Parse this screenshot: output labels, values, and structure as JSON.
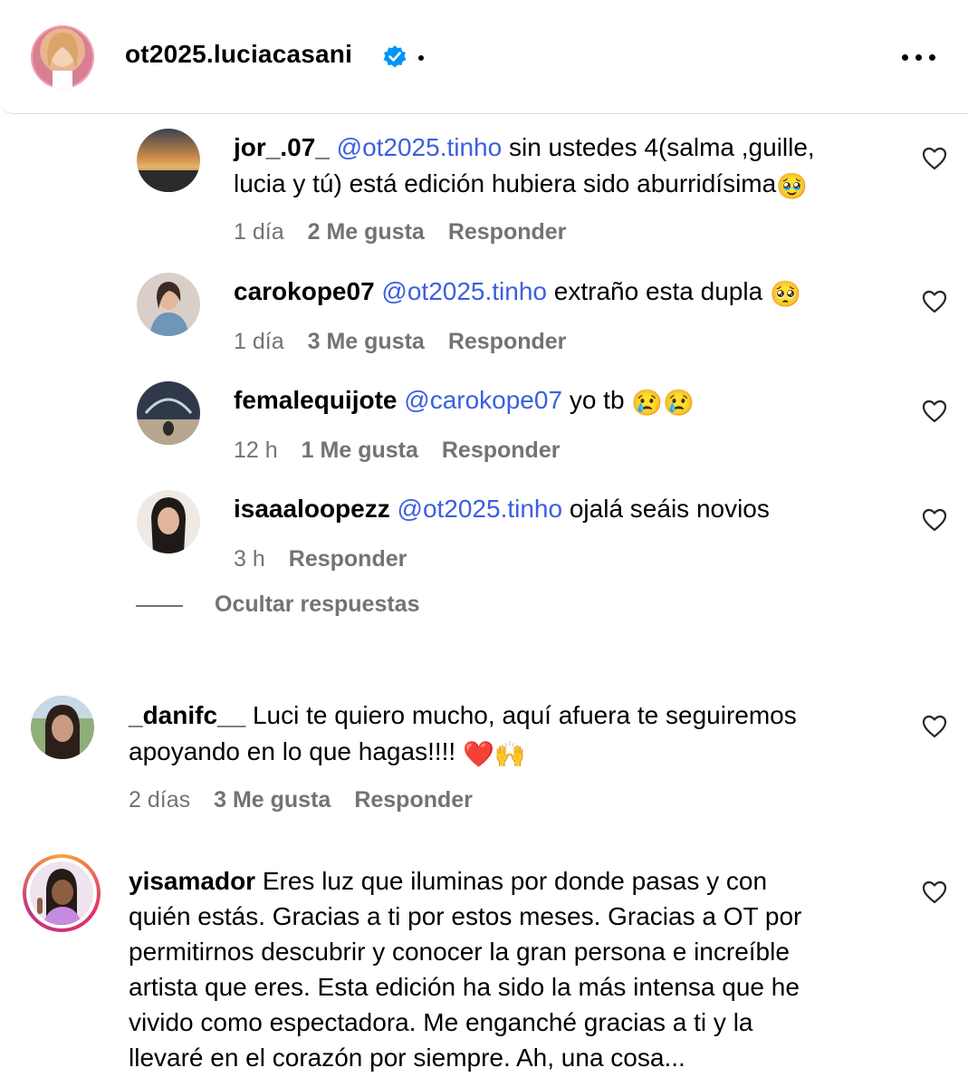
{
  "header": {
    "username": "ot2025.luciacasani",
    "verified": true,
    "more_label": "More options"
  },
  "colors": {
    "mention": "#3b5fe0",
    "verified_blue": "#0095f6",
    "meta_gray": "#737373"
  },
  "replies": [
    {
      "username": "jor_.07_",
      "mention": "@ot2025.tinho",
      "line1": "sin ustedes 4(salma ,guille,",
      "line2": "lucia y tú) está edición hubiera sido aburridísima",
      "emoji": "🥹",
      "time": "1 día",
      "likes": "2 Me gusta",
      "reply": "Responder"
    },
    {
      "username": "carokope07",
      "mention": "@ot2025.tinho",
      "text": "extraño esta dupla",
      "emoji": "🥺",
      "time": "1 día",
      "likes": "3 Me gusta",
      "reply": "Responder"
    },
    {
      "username": "femalequijote",
      "mention": "@carokope07",
      "text": "yo tb",
      "emoji": "😢😢",
      "time": "12 h",
      "likes": "1 Me gusta",
      "reply": "Responder"
    },
    {
      "username": "isaaaloopezz",
      "mention": "@ot2025.tinho",
      "text": "ojalá seáis novios",
      "time": "3 h",
      "reply": "Responder"
    }
  ],
  "hide_replies": "Ocultar respuestas",
  "comments": [
    {
      "username": "_danifc__",
      "line1": "Luci te quiero mucho, aquí afuera te seguiremos",
      "line2": "apoyando en lo que hagas!!!!",
      "emoji": "❤️🙌",
      "time": "2 días",
      "likes": "3 Me gusta",
      "reply": "Responder"
    },
    {
      "username": "yisamador",
      "line1": "Eres luz que iluminas por donde pasas y con",
      "line2": "quién estás. Gracias a ti por estos meses. Gracias a OT por",
      "line3": "permitirnos descubrir y conocer la gran persona e increíble",
      "line4": "artista que eres. Esta edición ha sido la más intensa que he",
      "line5": "vivido como espectadora. Me enganché gracias a ti y la",
      "line6": "llevaré en el corazón por siempre. Ah, una cosa..."
    }
  ]
}
